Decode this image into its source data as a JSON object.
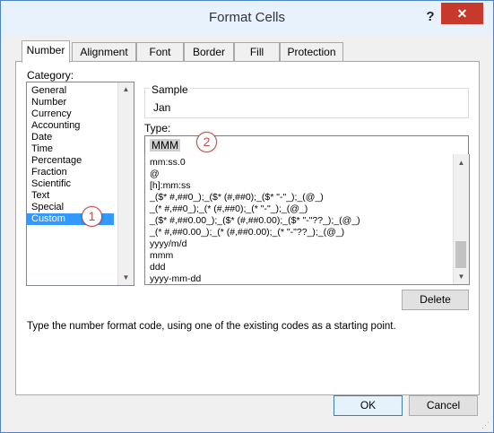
{
  "window": {
    "title": "Format Cells",
    "help_label": "?",
    "close_label": "✕"
  },
  "tabs": [
    {
      "label": "Number",
      "active": true
    },
    {
      "label": "Alignment",
      "active": false
    },
    {
      "label": "Font",
      "active": false
    },
    {
      "label": "Border",
      "active": false
    },
    {
      "label": "Fill",
      "active": false
    },
    {
      "label": "Protection",
      "active": false
    }
  ],
  "category": {
    "label": "Category:",
    "items": [
      "General",
      "Number",
      "Currency",
      "Accounting",
      "Date",
      "Time",
      "Percentage",
      "Fraction",
      "Scientific",
      "Text",
      "Special",
      "Custom"
    ],
    "selected": "Custom"
  },
  "sample": {
    "label": "Sample",
    "value": "Jan"
  },
  "type": {
    "label": "Type:",
    "value": "MMM",
    "formats": [
      "mm:ss.0",
      "@",
      "[h]:mm:ss",
      "_($* #,##0_);_($* (#,##0);_($* \"-\"_);_(@_)",
      "_(* #,##0_);_(* (#,##0);_(* \"-\"_);_(@_)",
      "_($* #,##0.00_);_($* (#,##0.00);_($* \"-\"??_);_(@_)",
      "_(* #,##0.00_);_(* (#,##0.00);_(* \"-\"??_);_(@_)",
      "yyyy/m/d",
      "mmm",
      "ddd",
      "yyyy-mm-dd"
    ]
  },
  "buttons": {
    "delete": "Delete",
    "ok": "OK",
    "cancel": "Cancel"
  },
  "hint": "Type the number format code, using one of the existing codes as a starting point.",
  "annotations": [
    "1",
    "2"
  ],
  "colors": {
    "title_bg": "#e7f2fc",
    "close_bg": "#c7392b",
    "selection": "#3399ff",
    "badge": "#c0504d"
  }
}
